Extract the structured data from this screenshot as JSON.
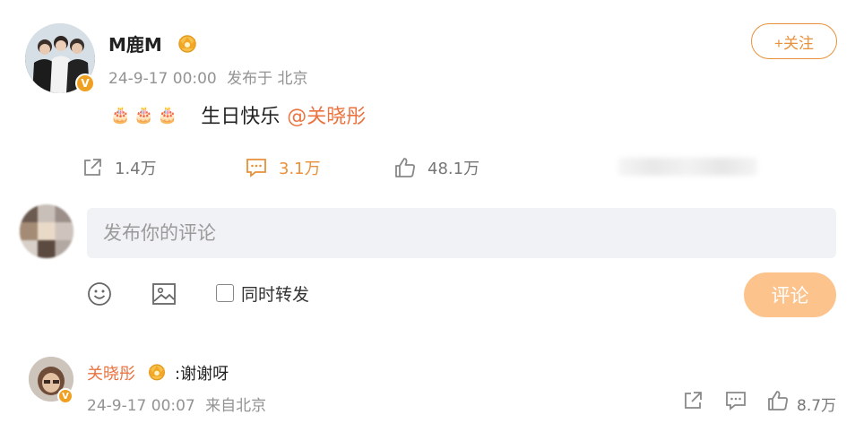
{
  "post": {
    "author": "M鹿M",
    "time": "24-9-17 00:00",
    "location": "发布于 北京",
    "cakes": "🎂🎂🎂",
    "text": "生日快乐",
    "mention": "@关晓彤",
    "follow_label": "+关注",
    "verify_badge": "V"
  },
  "actions": {
    "repost_count": "1.4万",
    "comment_count": "3.1万",
    "like_count": "48.1万"
  },
  "composer": {
    "placeholder": "发布你的评论",
    "repost_label": "同时转发",
    "submit_label": "评论"
  },
  "reply": {
    "author": "关晓彤",
    "text": ":谢谢呀",
    "time": "24-9-17 00:07",
    "location": "来自北京",
    "like_count": "8.7万",
    "verify_badge": "V"
  },
  "colors": {
    "accent": "#eb7340",
    "follow": "#e8913a",
    "submit_disabled": "#fcc48c",
    "verified": "#f0a020"
  },
  "icons": [
    "share-icon",
    "comment-icon",
    "like-icon",
    "emoji-icon",
    "image-icon",
    "crown-icon",
    "verified-icon"
  ]
}
